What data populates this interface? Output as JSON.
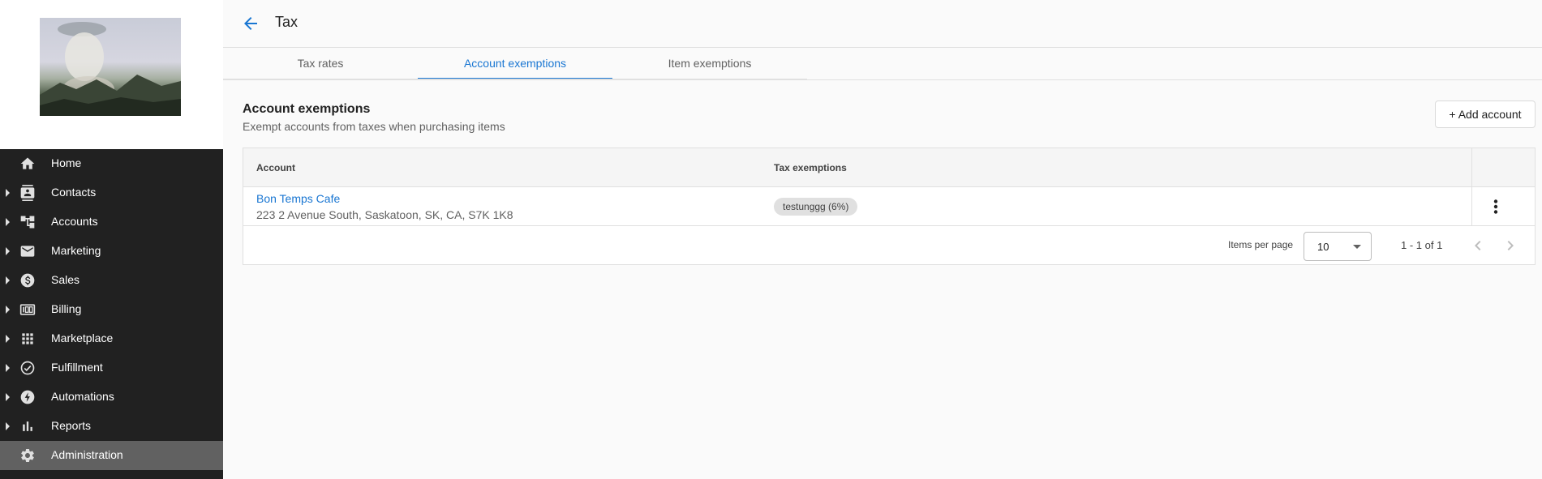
{
  "sidebar": {
    "items": [
      {
        "label": "Home",
        "icon": "home-icon",
        "expandable": false,
        "active": false
      },
      {
        "label": "Contacts",
        "icon": "contacts-icon",
        "expandable": true,
        "active": false
      },
      {
        "label": "Accounts",
        "icon": "accounts-icon",
        "expandable": true,
        "active": false
      },
      {
        "label": "Marketing",
        "icon": "mail-icon",
        "expandable": true,
        "active": false
      },
      {
        "label": "Sales",
        "icon": "dollar-icon",
        "expandable": true,
        "active": false
      },
      {
        "label": "Billing",
        "icon": "billing-icon",
        "expandable": true,
        "active": false
      },
      {
        "label": "Marketplace",
        "icon": "apps-grid-icon",
        "expandable": true,
        "active": false
      },
      {
        "label": "Fulfillment",
        "icon": "check-circle-icon",
        "expandable": true,
        "active": false
      },
      {
        "label": "Automations",
        "icon": "bolt-icon",
        "expandable": true,
        "active": false
      },
      {
        "label": "Reports",
        "icon": "bar-chart-icon",
        "expandable": true,
        "active": false
      },
      {
        "label": "Administration",
        "icon": "gear-icon",
        "expandable": false,
        "active": true
      }
    ]
  },
  "header": {
    "title": "Tax"
  },
  "tabs": [
    {
      "label": "Tax rates",
      "active": false
    },
    {
      "label": "Account exemptions",
      "active": true
    },
    {
      "label": "Item exemptions",
      "active": false
    }
  ],
  "section": {
    "title": "Account exemptions",
    "description": "Exempt accounts from taxes when purchasing items",
    "add_button": "+ Add account"
  },
  "table": {
    "columns": [
      "Account",
      "Tax exemptions"
    ],
    "rows": [
      {
        "account_name": "Bon Temps Cafe",
        "account_address": "223 2 Avenue South, Saskatoon, SK, CA, S7K 1K8",
        "exemptions": [
          "testunggg (6%)"
        ]
      }
    ]
  },
  "pagination": {
    "items_per_page_label": "Items per page",
    "items_per_page": "10",
    "range": "1 - 1 of 1"
  },
  "colors": {
    "accent": "#1976d2",
    "sidebar_bg": "#212121",
    "sidebar_active": "#616161"
  }
}
